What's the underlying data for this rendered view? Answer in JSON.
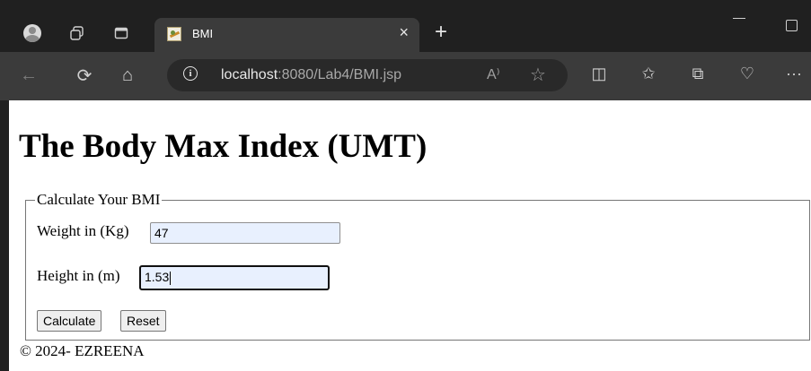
{
  "browser": {
    "tab_title": "BMI",
    "close_glyph": "×",
    "new_tab_glyph": "+",
    "url_host": "localhost",
    "url_rest": ":8080/Lab4/BMI.jsp",
    "read_aloud_glyph": "A⁾",
    "favorite_glyph": "☆",
    "info_glyph": "i",
    "back_glyph": "←",
    "reload_glyph": "⟳",
    "home_glyph": "⌂",
    "toolbar_glyphs": {
      "split": "◫",
      "favorites": "✩",
      "collections": "⧉",
      "health": "♡",
      "more": "···"
    },
    "icons": [
      "profile-icon",
      "workspaces-icon",
      "tab-actions-icon",
      "favicon-icon"
    ]
  },
  "page": {
    "heading": "The Body Max Index (UMT)",
    "legend": "Calculate Your BMI",
    "weight_label": "Weight in (Kg)",
    "weight_value": "47",
    "height_label": "Height in (m)",
    "height_value": "1.53",
    "calculate_label": "Calculate",
    "reset_label": "Reset",
    "footer": "© 2024- EZREENA"
  }
}
